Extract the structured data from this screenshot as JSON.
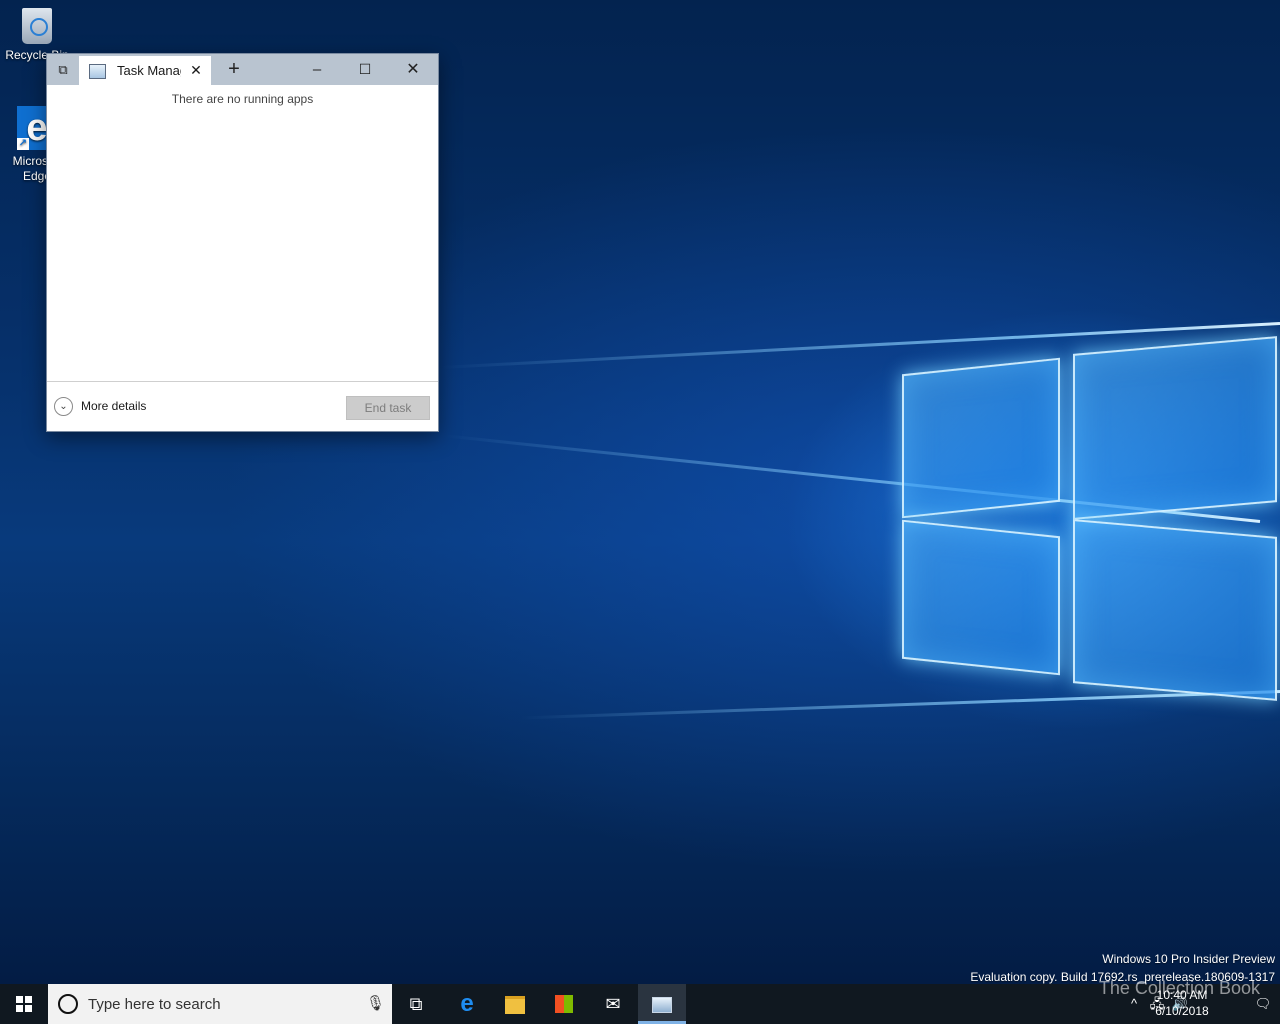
{
  "desktop": {
    "icons": [
      {
        "label": "Recycle Bin",
        "icon": "recycle-bin-icon"
      },
      {
        "label": "Microsoft Edge",
        "icon": "edge-icon"
      }
    ],
    "watermark": {
      "line1": "Windows 10 Pro Insider Preview",
      "line2": "Evaluation copy. Build 17692.rs_prerelease.180609-1317"
    },
    "overlay_logo_text": "The Collection Book"
  },
  "task_manager": {
    "tab_title": "Task Manager",
    "empty_message": "There are no running apps",
    "more_details_label": "More details",
    "end_task_label": "End task",
    "icons": {
      "tab_switcher": "window-switcher-icon",
      "app": "task-manager-icon",
      "tab_close": "close-icon",
      "new_tab": "plus-icon",
      "minimize": "minimize-icon",
      "maximize": "maximize-icon",
      "close": "close-icon",
      "more_details": "chevron-down-icon"
    }
  },
  "taskbar": {
    "search_placeholder": "Type here to search",
    "pinned": [
      {
        "name": "task-view",
        "icon": "task-view-icon"
      },
      {
        "name": "edge",
        "icon": "edge-icon"
      },
      {
        "name": "file-explorer",
        "icon": "folder-icon"
      },
      {
        "name": "store",
        "icon": "store-icon"
      },
      {
        "name": "mail",
        "icon": "mail-icon"
      },
      {
        "name": "task-manager",
        "icon": "task-manager-icon",
        "active": true
      }
    ],
    "tray": {
      "time": "10:40 AM",
      "date": "6/10/2018"
    },
    "colors": {
      "taskbar_bg": "#101820",
      "accent": "#0f6fd0",
      "active_underline": "#7fb2e6"
    }
  }
}
